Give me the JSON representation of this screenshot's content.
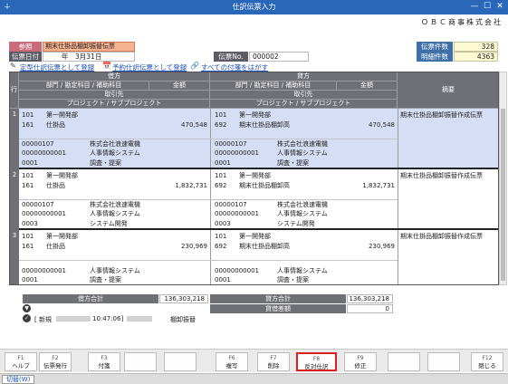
{
  "window": {
    "title": "仕訳伝票入力",
    "app_icon": "＋"
  },
  "company": "ＯＢＣ商事株式会社",
  "header": {
    "sanshou_label": "参照",
    "template_name": "期末仕掛品棚卸振替伝票",
    "date_label": "伝票日付",
    "date_value": "年　3月31日",
    "voucher_no_label": "伝票No.",
    "voucher_no_value": "000002",
    "count_label": "伝票件数",
    "count_value": "328",
    "detail_count_label": "明細件数",
    "detail_count_value": "4363"
  },
  "links": {
    "register_fixed": "定型仕訳伝票として登録",
    "register_scheduled": "予約仕訳伝票として登録",
    "attachments": "すべての付箋をはがす"
  },
  "grid": {
    "row_label": "行",
    "debit_label": "借方",
    "credit_label": "貸方",
    "subject_header": "部門 / 勘定科目 / 補助科目",
    "amount_header": "金額",
    "partner_header": "取引先",
    "project_header": "プロジェクト / サブプロジェクト",
    "remarks_header": "摘要",
    "rows": [
      {
        "no": "1",
        "d_code1": "101",
        "d_name1": "第一開発部",
        "d_code2": "161",
        "d_name2": "仕掛品",
        "d_amount": "470,548",
        "d_p1": "00000107",
        "d_p2": "00000000001",
        "d_p3": "0001",
        "d_pn1": "株式会社浪速電機",
        "d_pn2": "人事情報システム",
        "d_pn3": "調査・提案",
        "c_code1": "101",
        "c_name1": "第一開発部",
        "c_code2": "692",
        "c_name2": "期末仕掛品棚卸高",
        "c_amount": "470,548",
        "c_p1": "00000107",
        "c_p2": "00000000001",
        "c_p3": "0001",
        "c_pn1": "株式会社浪速電機",
        "c_pn2": "人事情報システム",
        "c_pn3": "調査・提案",
        "remarks": "期末仕掛品棚卸振替作成伝票"
      },
      {
        "no": "2",
        "d_code1": "101",
        "d_name1": "第一開発部",
        "d_code2": "161",
        "d_name2": "仕掛品",
        "d_amount": "1,832,731",
        "d_p1": "00000107",
        "d_p2": "00000000001",
        "d_p3": "0003",
        "d_pn1": "株式会社浪速電機",
        "d_pn2": "人事情報システム",
        "d_pn3": "システム開発",
        "c_code1": "101",
        "c_name1": "第一開発部",
        "c_code2": "692",
        "c_name2": "期末仕掛品棚卸高",
        "c_amount": "1,832,731",
        "c_p1": "00000107",
        "c_p2": "00000000001",
        "c_p3": "0003",
        "c_pn1": "株式会社浪速電機",
        "c_pn2": "人事情報システム",
        "c_pn3": "システム開発",
        "remarks": "期末仕掛品棚卸振替作成伝票"
      },
      {
        "no": "3",
        "d_code1": "101",
        "d_name1": "第一開発部",
        "d_code2": "161",
        "d_name2": "仕掛品",
        "d_amount": "230,969",
        "d_p1": "",
        "d_p2": "00000000001",
        "d_p3": "0001",
        "d_pn1": "",
        "d_pn2": "人事情報システム",
        "d_pn3": "調査・提案",
        "c_code1": "101",
        "c_name1": "第一開発部",
        "c_code2": "692",
        "c_name2": "期末仕掛品棚卸高",
        "c_amount": "230,969",
        "c_p1": "",
        "c_p2": "00000000001",
        "c_p3": "0001",
        "c_pn1": "",
        "c_pn2": "人事情報システム",
        "c_pn3": "調査・提案",
        "remarks": "期末仕掛品棚卸振替作成伝票"
      }
    ]
  },
  "totals": {
    "debit_total_label": "借方合計",
    "debit_total_value": "136,303,218",
    "credit_total_label": "貸方合計",
    "credit_total_value": "136,303,218",
    "diff_label": "貸借差額",
    "diff_value": "0"
  },
  "info_line": {
    "mode": "[ 新規",
    "time": "10:47:06]",
    "category": "棚卸振替"
  },
  "fkeys": [
    {
      "key": "F1",
      "label": "ヘルプ"
    },
    {
      "key": "F2",
      "label": "伝票発行"
    },
    {
      "key": "F3",
      "label": "付箋"
    },
    {
      "key": "",
      "label": ""
    },
    {
      "key": "",
      "label": ""
    },
    {
      "key": "F6",
      "label": "複写"
    },
    {
      "key": "F7",
      "label": "削除"
    },
    {
      "key": "F8",
      "label": "反対仕訳"
    },
    {
      "key": "F9",
      "label": "修正"
    },
    {
      "key": "",
      "label": ""
    },
    {
      "key": "",
      "label": ""
    },
    {
      "key": "F12",
      "label": "閉じる"
    }
  ],
  "status": {
    "switch_tab": "切替(W)"
  },
  "colors": {
    "titlebar": "#2a67b8",
    "selected_row": "#d6def5",
    "header_gray": "#6f6f76",
    "highlight": "#d92020"
  }
}
